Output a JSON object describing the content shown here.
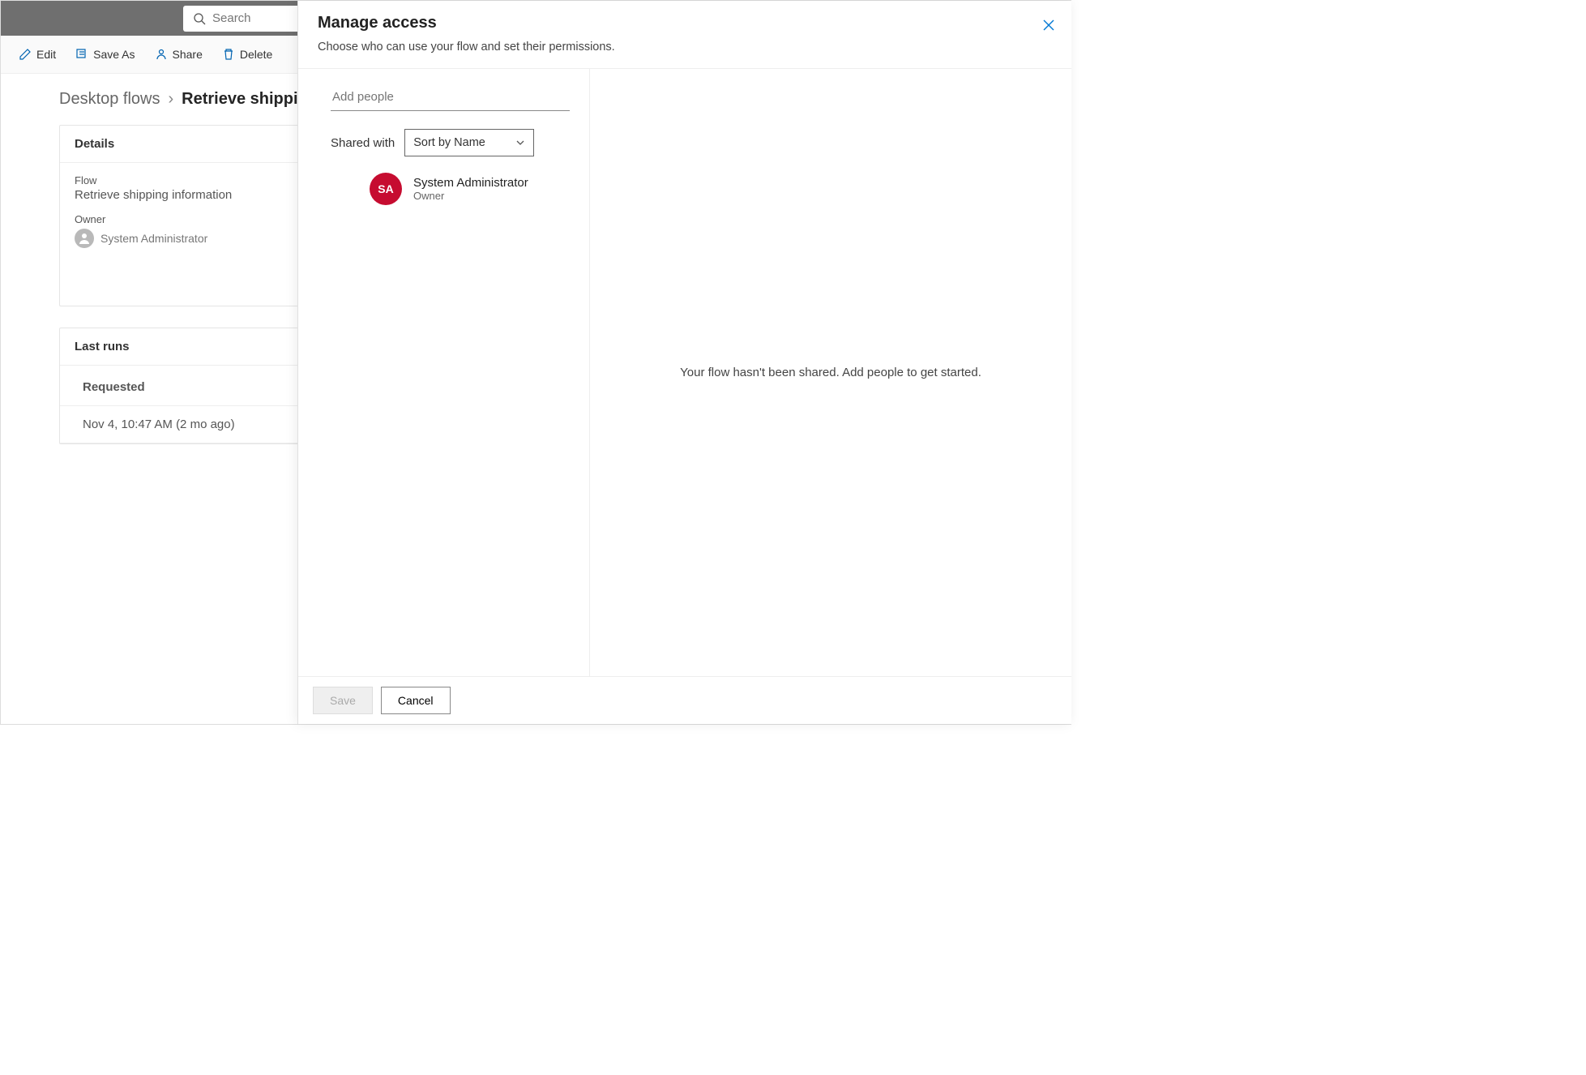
{
  "topbar": {
    "search_placeholder": "Search"
  },
  "toolbar": {
    "edit": "Edit",
    "saveAs": "Save As",
    "share": "Share",
    "delete": "Delete"
  },
  "breadcrumb": {
    "parent": "Desktop flows",
    "current": "Retrieve shipping i"
  },
  "details": {
    "title": "Details",
    "flow_label": "Flow",
    "flow_value": "Retrieve shipping information",
    "owner_label": "Owner",
    "owner_value": "System Administrator"
  },
  "runs": {
    "title": "Last runs",
    "column": "Requested",
    "row1": "Nov 4, 10:47 AM (2 mo ago)"
  },
  "panel": {
    "title": "Manage access",
    "subtitle": "Choose who can use your flow and set their permissions.",
    "add_people_placeholder": "Add people",
    "shared_with_label": "Shared with",
    "sort_value": "Sort by Name",
    "person": {
      "initials": "SA",
      "name": "System Administrator",
      "role": "Owner"
    },
    "empty_msg": "Your flow hasn't been shared. Add people to get started.",
    "save": "Save",
    "cancel": "Cancel"
  }
}
